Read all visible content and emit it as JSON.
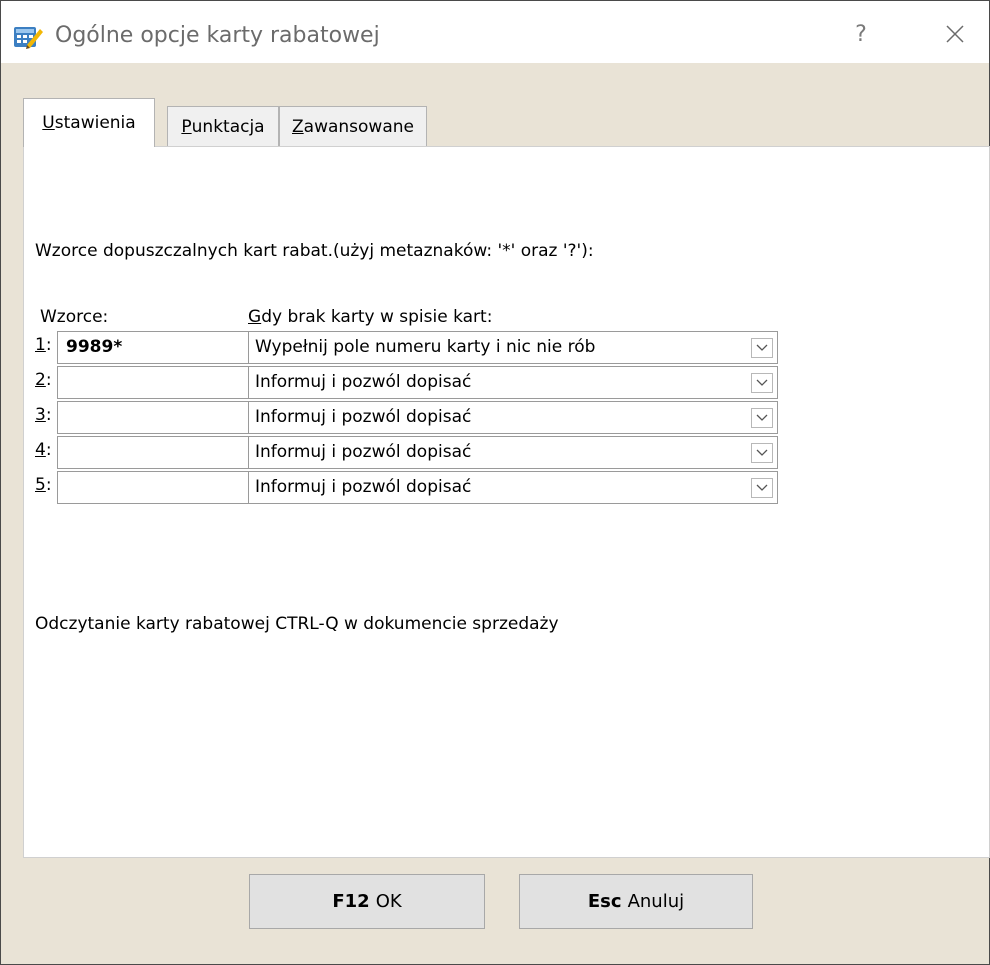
{
  "window": {
    "title": "Ogólne opcje karty rabatowej",
    "help_label": "?",
    "close_label": "✕"
  },
  "tabs": [
    {
      "label_underlined": "U",
      "label_rest": "stawienia",
      "active": true
    },
    {
      "label_underlined": "P",
      "label_rest": "unktacja",
      "active": false
    },
    {
      "label_underlined": "Z",
      "label_rest": "awansowane",
      "active": false
    }
  ],
  "panel": {
    "heading": "Wzorce dopuszczalnych kart rabat.(użyj metaznaków: '*' oraz '?'):",
    "col_patterns": "Wzorce:",
    "col_action_underlined": "G",
    "col_action_rest": "dy brak karty w spisie kart:",
    "rows": [
      {
        "num": "1",
        "pattern": "9989*",
        "action": "Wypełnij pole numeru karty i nic nie rób"
      },
      {
        "num": "2",
        "pattern": "",
        "action": "Informuj i pozwól dopisać"
      },
      {
        "num": "3",
        "pattern": "",
        "action": "Informuj i pozwól dopisać"
      },
      {
        "num": "4",
        "pattern": "",
        "action": "Informuj i pozwól dopisać"
      },
      {
        "num": "5",
        "pattern": "",
        "action": "Informuj i pozwól dopisać"
      }
    ],
    "footer_text": "Odczytanie karty rabatowej CTRL-Q w dokumencie sprzedaży"
  },
  "buttons": {
    "ok_key": "F12",
    "ok_label": "OK",
    "cancel_key": "Esc",
    "cancel_label": "Anuluj"
  }
}
